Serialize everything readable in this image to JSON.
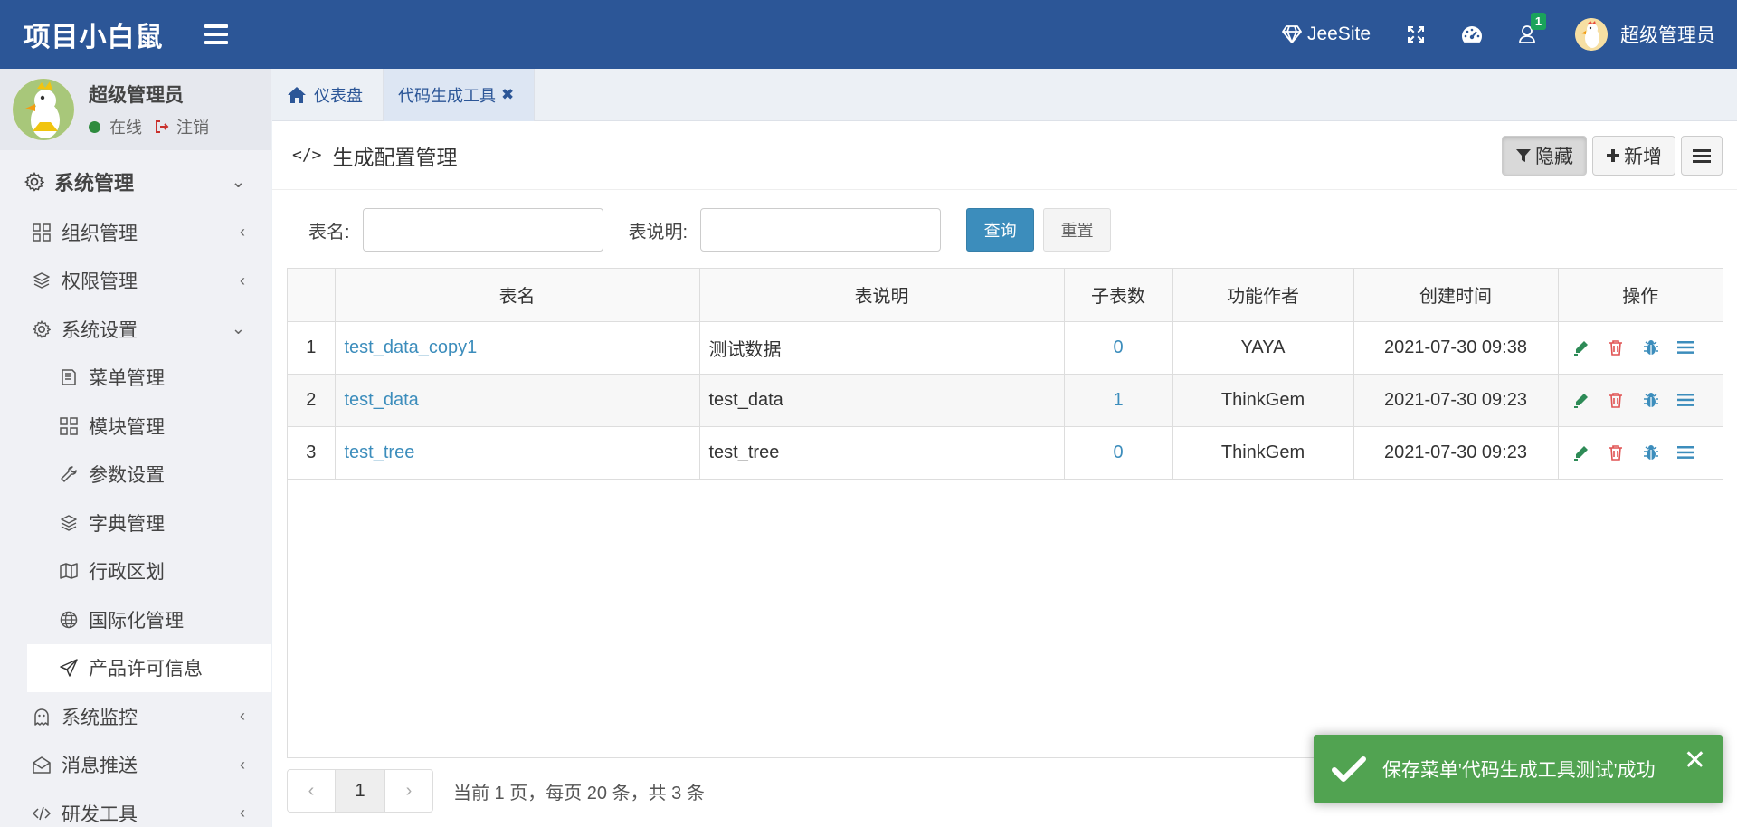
{
  "header": {
    "brand": "项目小白鼠",
    "site_name": "JeeSite",
    "notification_count": "1",
    "user_name": "超级管理员"
  },
  "sidebar": {
    "user": {
      "name": "超级管理员",
      "status": "在线",
      "logout": "注销"
    },
    "section": "系统管理",
    "items": [
      {
        "label": "组织管理",
        "icon": "grid-icon"
      },
      {
        "label": "权限管理",
        "icon": "layers-icon"
      },
      {
        "label": "系统设置",
        "icon": "gear-icon"
      },
      {
        "label": "菜单管理",
        "icon": "book-icon"
      },
      {
        "label": "模块管理",
        "icon": "grid-icon"
      },
      {
        "label": "参数设置",
        "icon": "wrench-icon"
      },
      {
        "label": "字典管理",
        "icon": "layers-icon"
      },
      {
        "label": "行政区划",
        "icon": "map-icon"
      },
      {
        "label": "国际化管理",
        "icon": "globe-icon"
      },
      {
        "label": "产品许可信息",
        "icon": "paper-plane-icon"
      },
      {
        "label": "系统监控",
        "icon": "ghost-icon"
      },
      {
        "label": "消息推送",
        "icon": "envelope-open-icon"
      },
      {
        "label": "研发工具",
        "icon": "code-icon"
      }
    ]
  },
  "tabs": [
    {
      "label": "仪表盘"
    },
    {
      "label": "代码生成工具"
    }
  ],
  "panel": {
    "title": "生成配置管理",
    "btn_hide": "隐藏",
    "btn_add": "新增"
  },
  "search": {
    "table_name_label": "表名:",
    "table_desc_label": "表说明:",
    "query": "查询",
    "reset": "重置"
  },
  "table": {
    "columns": [
      "表名",
      "表说明",
      "子表数",
      "功能作者",
      "创建时间",
      "操作"
    ],
    "rows": [
      {
        "idx": "1",
        "name": "test_data_copy1",
        "desc": "测试数据",
        "sub": "0",
        "author": "YAYA",
        "time": "2021-07-30 09:38"
      },
      {
        "idx": "2",
        "name": "test_data",
        "desc": "test_data",
        "sub": "1",
        "author": "ThinkGem",
        "time": "2021-07-30 09:23"
      },
      {
        "idx": "3",
        "name": "test_tree",
        "desc": "test_tree",
        "sub": "0",
        "author": "ThinkGem",
        "time": "2021-07-30 09:23"
      }
    ]
  },
  "pager": {
    "prev": "‹",
    "page": "1",
    "next": "›",
    "info": "当前 1 页，每页 20 条，共 3 条"
  },
  "toast": {
    "message": "保存菜单'代码生成工具测试'成功",
    "close": "✕"
  },
  "colors": {
    "brand": "#2c5697",
    "link": "#3c8dbc",
    "success": "#51a351",
    "edit": "#2e8b57",
    "delete": "#e05252"
  }
}
